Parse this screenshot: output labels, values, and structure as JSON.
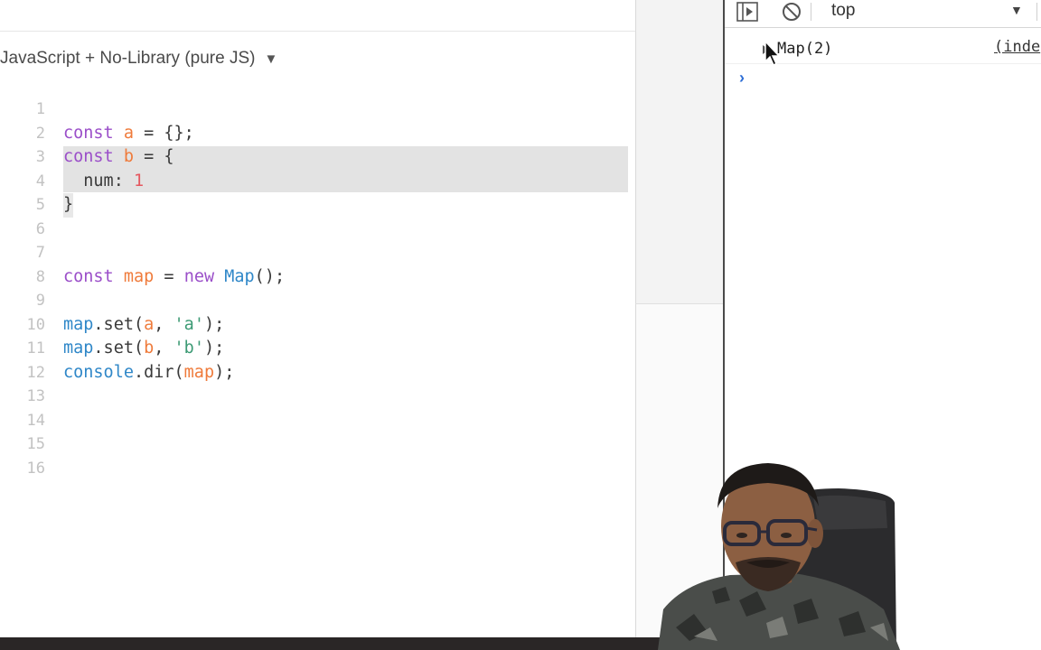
{
  "editor": {
    "language_label": "JavaScript + No-Library (pure JS)",
    "caret_icon": "▼",
    "lines": [
      {
        "n": "1"
      },
      {
        "n": "2"
      },
      {
        "n": "3"
      },
      {
        "n": "4"
      },
      {
        "n": "5"
      },
      {
        "n": "6"
      },
      {
        "n": "7"
      },
      {
        "n": "8"
      },
      {
        "n": "9"
      },
      {
        "n": "10"
      },
      {
        "n": "11"
      },
      {
        "n": "12"
      },
      {
        "n": "13"
      },
      {
        "n": "14"
      },
      {
        "n": "15"
      },
      {
        "n": "16"
      }
    ],
    "tokens": {
      "l2_kw": "const",
      "l2_var": "a",
      "l2_rest": " = {};",
      "l3_kw": "const",
      "l3_var": "b",
      "l3_rest": " = {",
      "l4_key": "  num: ",
      "l4_num": "1",
      "l5_text": "}",
      "l8_kw": "const",
      "l8_var": "map",
      "l8_eq": " = ",
      "l8_new": "new",
      "l8_cls": "Map",
      "l8_rest": "();",
      "l10_obj": "map",
      "l10_m": ".set(",
      "l10_arg": "a",
      "l10_sep": ", ",
      "l10_str": "'a'",
      "l10_end": ");",
      "l11_obj": "map",
      "l11_m": ".set(",
      "l11_arg": "b",
      "l11_sep": ", ",
      "l11_str": "'b'",
      "l11_end": ");",
      "l12_obj": "console",
      "l12_m": ".dir(",
      "l12_arg": "map",
      "l12_end": ");"
    }
  },
  "devtools": {
    "context_label": "top",
    "context_caret": "▼",
    "log_entry": "Map(2)",
    "log_source": "(inde",
    "prompt_symbol": "›"
  },
  "colors": {
    "keyword": "#9b4fc9",
    "variable": "#ef7b3b",
    "number": "#e4575f",
    "function": "#2f87c8",
    "string": "#3c9a74",
    "highlight": "#e3e3e3"
  },
  "icons": [
    "play-panel-icon",
    "clear-console-icon",
    "dropdown-caret-icon",
    "expand-triangle-icon",
    "mouse-cursor-icon"
  ]
}
